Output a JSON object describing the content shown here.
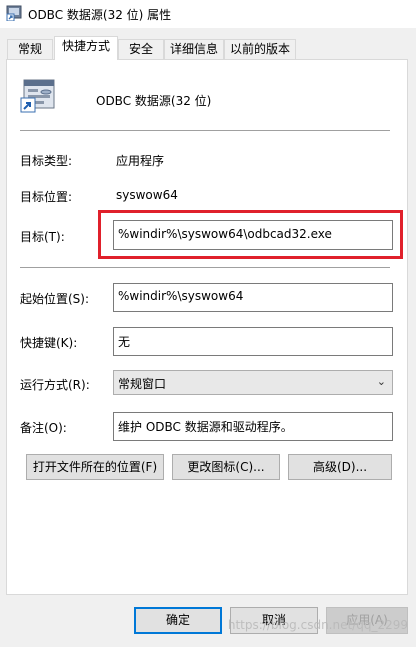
{
  "window": {
    "title": "ODBC 数据源(32 位) 属性",
    "icon": "shortcut-app-icon"
  },
  "tabs": [
    {
      "label": "常规",
      "active": false
    },
    {
      "label": "快捷方式",
      "active": true
    },
    {
      "label": "安全",
      "active": false
    },
    {
      "label": "详细信息",
      "active": false
    },
    {
      "label": "以前的版本",
      "active": false
    }
  ],
  "header": {
    "name": "ODBC 数据源(32 位)",
    "icon": "odbc-shortcut-icon"
  },
  "fields": {
    "target_type_label": "目标类型:",
    "target_type_value": "应用程序",
    "target_location_label": "目标位置:",
    "target_location_value": "syswow64",
    "target_label": "目标(T):",
    "target_value": "%windir%\\syswow64\\odbcad32.exe",
    "start_in_label": "起始位置(S):",
    "start_in_value": "%windir%\\syswow64",
    "shortcut_key_label": "快捷键(K):",
    "shortcut_key_value": "无",
    "run_label": "运行方式(R):",
    "run_value": "常规窗口",
    "comment_label": "备注(O):",
    "comment_value": "维护 ODBC 数据源和驱动程序。"
  },
  "buttons": {
    "open_location": "打开文件所在的位置(F)",
    "change_icon": "更改图标(C)...",
    "advanced": "高级(D)...",
    "ok": "确定",
    "cancel": "取消",
    "apply": "应用(A)"
  },
  "watermark": "https://blog.csdn.net/qq_2299",
  "colors": {
    "highlight_border": "#e0202b",
    "default_button_border": "#0078d7"
  }
}
